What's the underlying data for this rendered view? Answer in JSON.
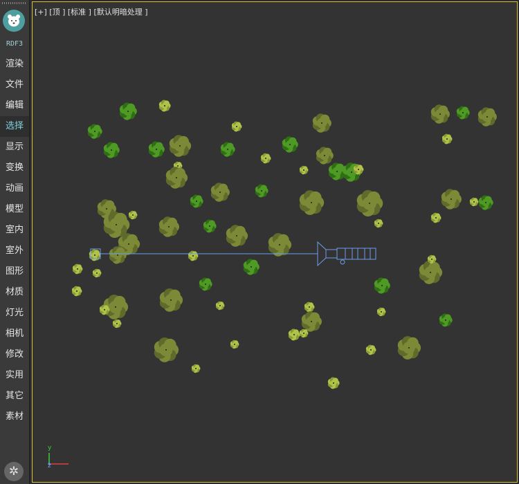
{
  "sidebar": {
    "plugin_name": "RDF3",
    "menu": [
      "渲染",
      "文件",
      "编辑",
      "选择",
      "显示",
      "变换",
      "动画",
      "模型",
      "室内",
      "室外",
      "图形",
      "材质",
      "灯光",
      "相机",
      "修改",
      "实用",
      "其它",
      "素材"
    ],
    "active_index": 3,
    "logo_icon": "bear-logo-icon",
    "settings_icon": "gear-icon"
  },
  "viewport": {
    "label": "[+] [顶 ] [标准 ] [默认明暗处理 ]",
    "axis_y": "y",
    "axis_z": "z",
    "border_color": "#d6c23b",
    "background": "#333333"
  },
  "colors": {
    "tree_olive": "#6b7a2f",
    "tree_green": "#3f8a1e",
    "tree_light": "#9bb040",
    "camera_line": "#6d9de8"
  }
}
